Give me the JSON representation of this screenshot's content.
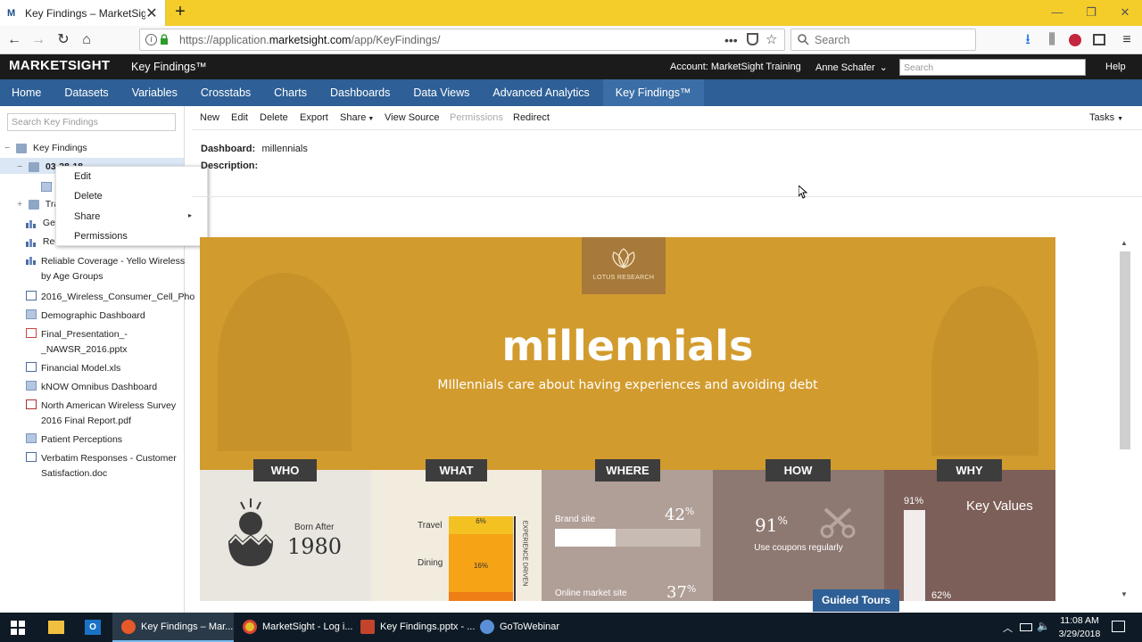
{
  "browser": {
    "tab_title": "Key Findings – MarketSight",
    "tab_favicon": "M",
    "url_host_prefix": "https://application.",
    "url_host": "marketsight.com",
    "url_path": "/app/KeyFindings/",
    "search_placeholder": "Search",
    "win_min": "—",
    "win_restore": "❐",
    "win_close": "✕"
  },
  "app": {
    "logo": "MARKETSIGHT",
    "title": "Key Findings™",
    "account": "Account: MarketSight Training",
    "user": "Anne Schafer",
    "search_placeholder": "Search",
    "help": "Help"
  },
  "main_nav": [
    "Home",
    "Datasets",
    "Variables",
    "Crosstabs",
    "Charts",
    "Dashboards",
    "Data Views",
    "Advanced Analytics",
    "Key Findings™"
  ],
  "left_panel": {
    "search_placeholder": "Search Key Findings",
    "root": "Key Findings",
    "selected": "03-28-18",
    "trai": "Trai",
    "gen": "Gen",
    "rec": "Rec",
    "items": [
      {
        "label1": "Reliable Coverage - Yello Wireless",
        "label2": "by Age Groups",
        "icon": "chart-icon"
      },
      {
        "label1": "2016_Wireless_Consumer_Cell_Pho",
        "label2": "",
        "icon": "doc-icon"
      },
      {
        "label1": "Demographic Dashboard",
        "label2": "",
        "icon": "dashboard-icon"
      },
      {
        "label1": "Final_Presentation_-",
        "label2": "_NAWSR_2016.pptx",
        "icon": "ppt-icon"
      },
      {
        "label1": "Financial Model.xls",
        "label2": "",
        "icon": "xls-icon"
      },
      {
        "label1": "kNOW Omnibus Dashboard",
        "label2": "",
        "icon": "dashboard-icon"
      },
      {
        "label1": "North American Wireless Survey",
        "label2": "2016 Final Report.pdf",
        "icon": "pdf-icon"
      },
      {
        "label1": "Patient Perceptions",
        "label2": "",
        "icon": "dashboard-icon"
      },
      {
        "label1": "Verbatim Responses - Customer",
        "label2": "Satisfaction.doc",
        "icon": "doc-icon"
      }
    ]
  },
  "context_menu": {
    "edit": "Edit",
    "delete": "Delete",
    "share": "Share",
    "permissions": "Permissions"
  },
  "toolbar": {
    "new": "New",
    "edit": "Edit",
    "delete": "Delete",
    "export": "Export",
    "share": "Share",
    "view_source": "View Source",
    "permissions": "Permissions",
    "redirect": "Redirect",
    "tasks": "Tasks"
  },
  "dashboard_info": {
    "dashboard_label": "Dashboard:",
    "dashboard_value": "millennials",
    "description_label": "Description:"
  },
  "infographic": {
    "logo_text": "LOTUS RESEARCH",
    "title": "millennials",
    "subtitle": "MIllennials care about having experiences and avoiding debt",
    "who": {
      "header": "WHO",
      "born_label": "Born After",
      "year": "1980"
    },
    "what": {
      "header": "WHAT",
      "travel": "Travel",
      "dining": "Dining",
      "travel_pct": "6%",
      "dining_pct": "16%",
      "side": "EXPERIENCE DRIVEN"
    },
    "where": {
      "header": "WHERE",
      "brand_label": "Brand site",
      "brand_value": "42",
      "brand_fraction": 0.42,
      "online_label": "Online market site",
      "online_value": "37",
      "pct": "%"
    },
    "how": {
      "header": "HOW",
      "value": "91",
      "pct": "%",
      "caption": "Use coupons regularly"
    },
    "why": {
      "header": "WHY",
      "key_values": "Key Values",
      "top_pct": "91%",
      "bottom_pct": "62%"
    }
  },
  "guided_tours": "Guided Tours",
  "taskbar": {
    "items": [
      "Key Findings – Mar...",
      "MarketSight - Log i...",
      "Key Findings.pptx - ...",
      "GoToWebinar"
    ],
    "time": "11:08 AM",
    "date": "3/29/2018"
  }
}
